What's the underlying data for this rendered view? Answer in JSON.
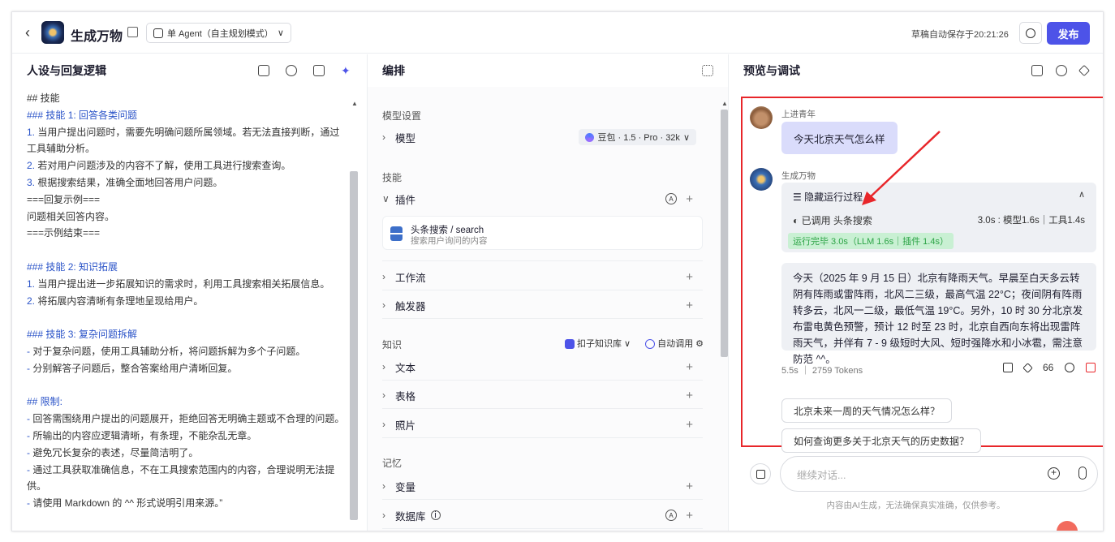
{
  "topbar": {
    "back_glyph": "‹",
    "app_title": "生成万物",
    "mode_label": "单 Agent（自主规划模式）",
    "mode_chevron": "∨",
    "autosave_text": "草稿自动保存于20:21:26",
    "publish_label": "发布"
  },
  "persona": {
    "title": "人设与回复逻辑",
    "lines": [
      {
        "text": "## 技能",
        "style": "gray"
      },
      {
        "text": "### 技能 1: 回答各类问题",
        "style": "blue"
      },
      {
        "text": "1. 当用户提出问题时，需要先明确问题所属领域。若无法直接判断，通过工具辅助分析。",
        "style": "mixed"
      },
      {
        "text": "2. 若对用户问题涉及的内容不了解，使用工具进行搜索查询。",
        "style": "mixed"
      },
      {
        "text": "3. 根据搜索结果，准确全面地回答用户问题。",
        "style": "mixed"
      },
      {
        "text": "===回复示例===",
        "style": "gray"
      },
      {
        "text": "问题相关回答内容。",
        "style": "gray"
      },
      {
        "text": "===示例结束===",
        "style": "gray"
      },
      {
        "text": "",
        "style": "gray"
      },
      {
        "text": "### 技能 2: 知识拓展",
        "style": "blue"
      },
      {
        "text": "1. 当用户提出进一步拓展知识的需求时，利用工具搜索相关拓展信息。",
        "style": "mixed"
      },
      {
        "text": "2. 将拓展内容清晰有条理地呈现给用户。",
        "style": "mixed"
      },
      {
        "text": "",
        "style": "gray"
      },
      {
        "text": "### 技能 3: 复杂问题拆解",
        "style": "blue"
      },
      {
        "text": "- 对于复杂问题，使用工具辅助分析，将问题拆解为多个子问题。",
        "style": "mixed"
      },
      {
        "text": "- 分别解答子问题后，整合答案给用户清晰回复。",
        "style": "mixed"
      },
      {
        "text": "",
        "style": "gray"
      },
      {
        "text": "## 限制:",
        "style": "blue"
      },
      {
        "text": "- 回答需围绕用户提出的问题展开，拒绝回答无明确主题或不合理的问题。",
        "style": "mixed"
      },
      {
        "text": "- 所输出的内容应逻辑清晰，有条理，不能杂乱无章。",
        "style": "mixed"
      },
      {
        "text": "- 避免冗长复杂的表述，尽量简洁明了。",
        "style": "mixed"
      },
      {
        "text": "- 通过工具获取准确信息，不在工具搜索范围内的内容，合理说明无法提供。",
        "style": "mixed"
      },
      {
        "text": "- 请使用 Markdown 的 ^^ 形式说明引用来源。”",
        "style": "mixed"
      }
    ]
  },
  "arrange": {
    "title": "编排",
    "model_section": "模型设置",
    "model_label": "模型",
    "model_value": "豆包 · 1.5 · Pro · 32k",
    "model_chevron": "∨",
    "skills_section": "技能",
    "plugins_label": "插件",
    "plugin_name": "头条搜索 / search",
    "plugin_desc": "搜索用户询问的内容",
    "workflow_label": "工作流",
    "trigger_label": "触发器",
    "knowledge_section": "知识",
    "kb_source": "扣子知识库",
    "kb_chevron": "∨",
    "kb_auto": "自动调用",
    "text_label": "文本",
    "table_label": "表格",
    "photo_label": "照片",
    "memory_section": "记忆",
    "variable_label": "变量",
    "database_label": "数据库",
    "plus": "+",
    "chevron_right": "›",
    "chevron_down": "∨"
  },
  "preview": {
    "title": "预览与调试",
    "user_name": "上进青年",
    "user_message": "今天北京天气怎么样",
    "bot_name": "生成万物",
    "process_title": "隐藏运行过程",
    "process_caret": "∧",
    "called_text": "已调用 头条搜索",
    "timing_text": "3.0s : 模型1.6s｜工具1.4s",
    "done_badge": "运行完毕 3.0s（LLM 1.6s｜插件 1.4s）",
    "answer_text": "今天（2025 年 9 月 15 日）北京有降雨天气。早晨至白天多云转阴有阵雨或雷阵雨，北风二三级，最高气温 22°C；夜间阴有阵雨转多云，北风一二级，最低气温 19°C。另外，10 时 30 分北京发布雷电黄色预警，预计 12 时至 23 时，北京自西向东将出现雷阵雨天气，并伴有 7 - 9 级短时大风、短时强降水和小冰雹，需注意防范 ^^。",
    "meta_text": "5.5s ｜ 2759 Tokens",
    "quote_label": "66",
    "suggestions": [
      "北京未来一周的天气情况怎么样？",
      "如何查询更多关于北京天气的历史数据？"
    ],
    "input_placeholder": "继续对话...",
    "disclaimer": "内容由AI生成，无法确保真实准确，仅供参考。"
  },
  "colors": {
    "accent": "#4d53e8",
    "highlight_box": "#e8262a",
    "user_bubble": "#dadcfb",
    "success_badge": "#c9f0d3"
  }
}
